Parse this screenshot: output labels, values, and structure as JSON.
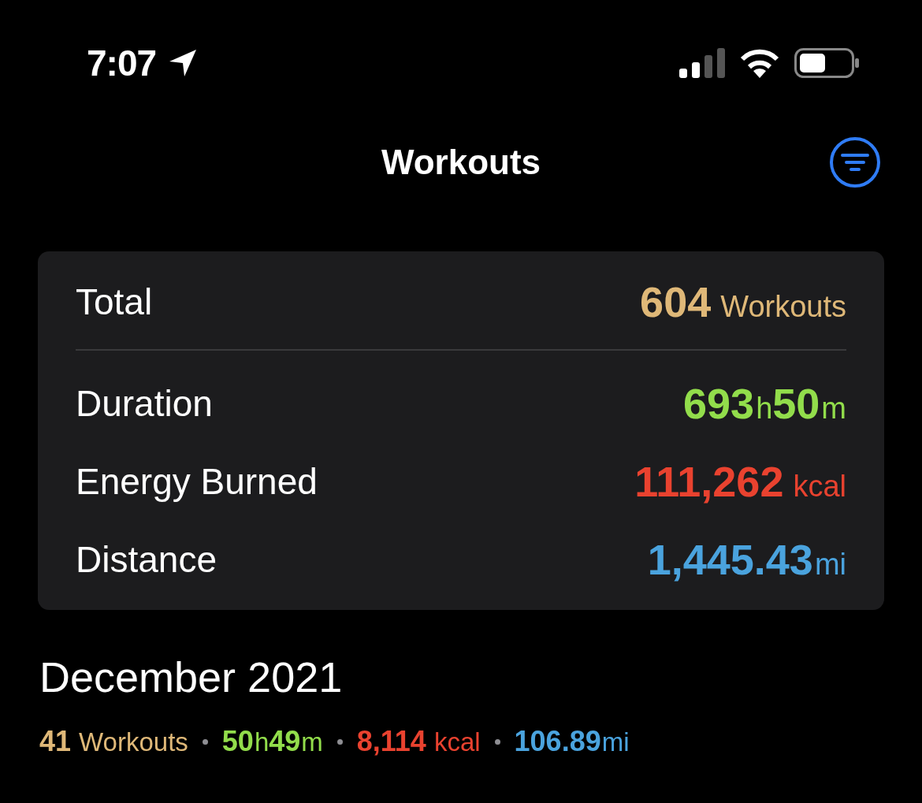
{
  "status_bar": {
    "time": "7:07"
  },
  "nav": {
    "title": "Workouts"
  },
  "summary": {
    "rows": [
      {
        "label": "Total",
        "kind": "header",
        "color": "#dfb878",
        "parts": [
          {
            "value": "604",
            "unit": "Workouts"
          }
        ]
      },
      {
        "label": "Duration",
        "kind": "metric",
        "color": "#92dd4b",
        "parts": [
          {
            "value": "693",
            "unit": "h"
          },
          {
            "value": "50",
            "unit": "m"
          }
        ]
      },
      {
        "label": "Energy Burned",
        "kind": "metric",
        "color": "#e9422f",
        "parts": [
          {
            "value": "111,262",
            "unit": "kcal"
          }
        ]
      },
      {
        "label": "Distance",
        "kind": "metric",
        "color": "#4aa3de",
        "parts": [
          {
            "value": "1,445.43",
            "unit": "mi"
          }
        ]
      }
    ]
  },
  "month": {
    "title": "December 2021",
    "stats": [
      {
        "color": "#dfb878",
        "parts": [
          {
            "value": "41",
            "unit": "Workouts"
          }
        ]
      },
      {
        "color": "#92dd4b",
        "parts": [
          {
            "value": "50",
            "unit": "h"
          },
          {
            "value": "49",
            "unit": "m"
          }
        ]
      },
      {
        "color": "#e9422f",
        "parts": [
          {
            "value": "8,114",
            "unit": "kcal"
          }
        ]
      },
      {
        "color": "#4aa3de",
        "parts": [
          {
            "value": "106.89",
            "unit": "mi"
          }
        ]
      }
    ]
  }
}
